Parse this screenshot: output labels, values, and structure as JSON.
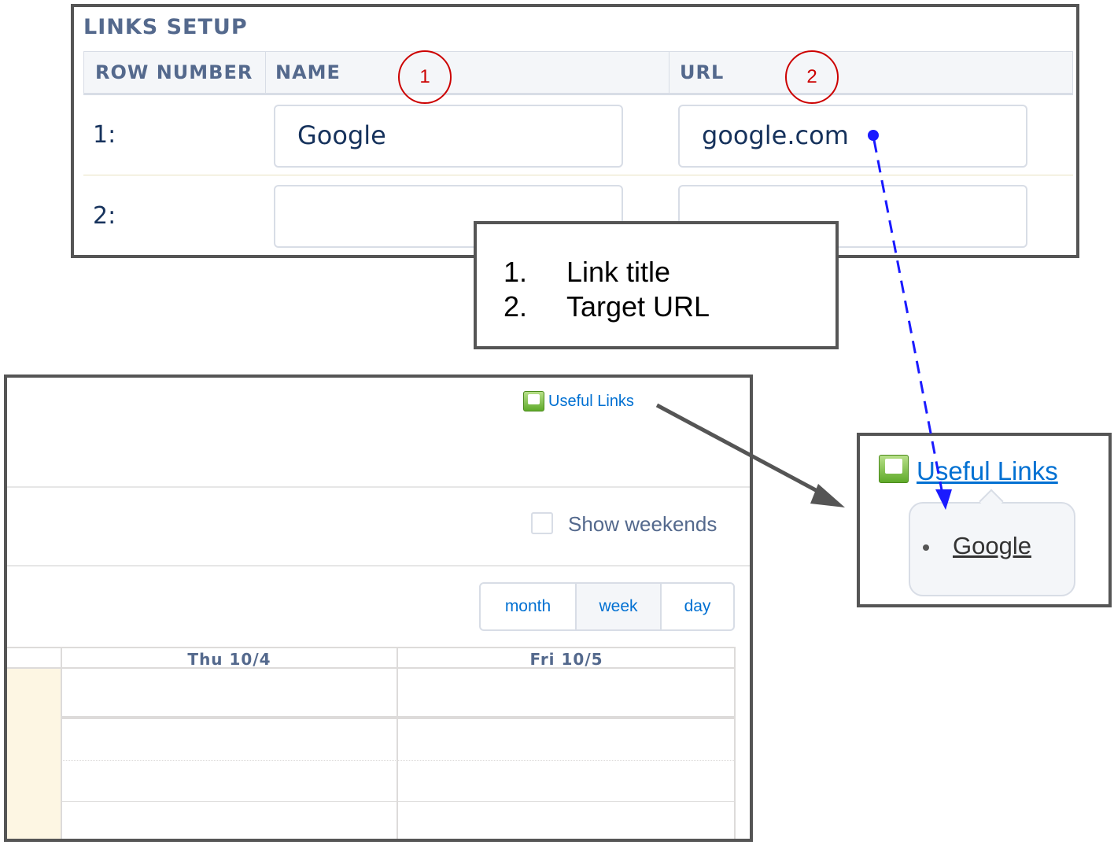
{
  "links_setup": {
    "title": "LINKS SETUP",
    "columns": [
      "ROW NUMBER",
      "NAME",
      "URL"
    ],
    "rows": [
      {
        "label": "1:",
        "name": "Google",
        "url": "google.com"
      },
      {
        "label": "2:",
        "name": "",
        "url": ""
      }
    ]
  },
  "markers": [
    "1",
    "2"
  ],
  "legend": {
    "items": [
      {
        "num": "1.",
        "text": "Link title"
      },
      {
        "num": "2.",
        "text": "Target URL"
      }
    ]
  },
  "calendar": {
    "useful_links_label": "Useful Links",
    "show_weekends_label": "Show weekends",
    "show_weekends_checked": false,
    "view_buttons": [
      "month",
      "week",
      "day"
    ],
    "active_view": "week",
    "day_headers": [
      "Thu 10/4",
      "Fri 10/5"
    ]
  },
  "zoom": {
    "useful_links_label": "Useful Links",
    "link_items": [
      "Google"
    ]
  },
  "colors": {
    "frame": "#555555",
    "link_blue": "#0070d2",
    "marker_red": "#cc0000",
    "arrow_blue": "#1a1aff",
    "arrow_gray": "#555555",
    "today_column": "#fdf6e3"
  },
  "icons": [
    "google-calendar-icon",
    "checkbox-icon",
    "bullet-icon"
  ]
}
